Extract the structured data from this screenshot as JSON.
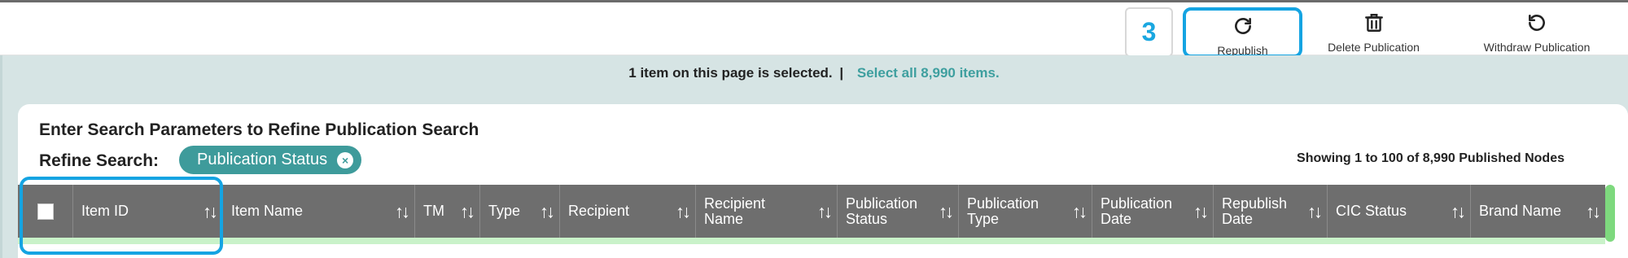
{
  "toolbar": {
    "step_number": "3",
    "republish_label": "Republish",
    "delete_label": "Delete Publication",
    "withdraw_label": "Withdraw Publication"
  },
  "selection": {
    "message": "1 item on this page is selected.",
    "separator": "|",
    "select_all_link": "Select all 8,990 items."
  },
  "search": {
    "title": "Enter Search Parameters to Refine Publication Search",
    "refine_label": "Refine Search:",
    "chip_label": "Publication Status",
    "chip_remove": "×",
    "showing_text": "Showing 1 to 100 of 8,990 Published Nodes"
  },
  "table": {
    "columns": [
      {
        "label": "Item ID"
      },
      {
        "label": "Item Name"
      },
      {
        "label": "TM"
      },
      {
        "label": "Type"
      },
      {
        "label": "Recipient"
      },
      {
        "label": "Recipient Name"
      },
      {
        "label": "Publication Status"
      },
      {
        "label": "Publication Type"
      },
      {
        "label": "Publication Date"
      },
      {
        "label": "Republish Date"
      },
      {
        "label": "CIC Status"
      },
      {
        "label": "Brand Name"
      }
    ],
    "sort_glyph": "↑↓"
  },
  "colors": {
    "accent_blue": "#15a4e2",
    "teal": "#3e9b9b",
    "header_gray": "#6e6e6e",
    "panel_bg": "#d6e4e4"
  }
}
